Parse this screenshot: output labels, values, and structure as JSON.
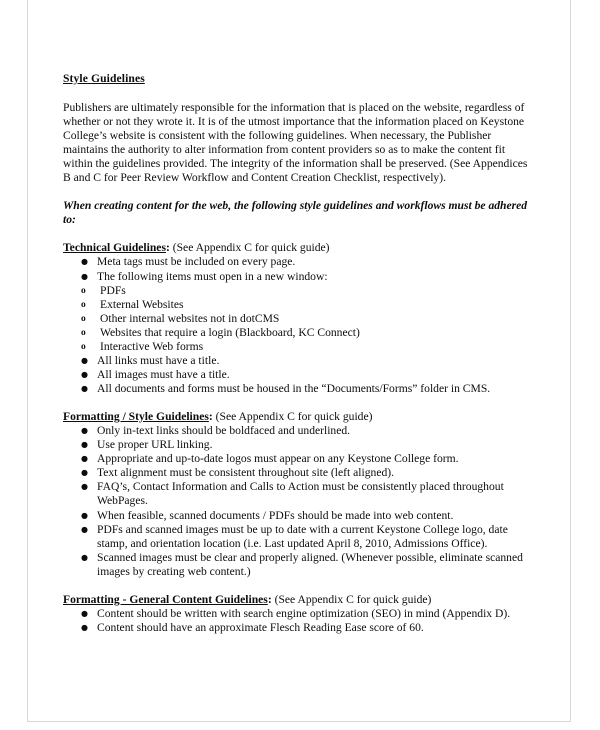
{
  "document": {
    "title": "Style Guidelines",
    "intro_paragraph": "Publishers are ultimately responsible for the information that is placed on the website, regardless of whether or not they wrote it. It is of the utmost importance that the information placed on Keystone College’s website is consistent with the following guidelines. When necessary, the Publisher maintains the authority to alter information from content providers so as to make the content fit within the guidelines provided. The integrity of the information shall be preserved. (See Appendices B and C for Peer Review Workflow and Content Creation Checklist, respectively).",
    "lead_statement": "When creating content for the web, the following style guidelines and workflows must be adhered to:",
    "bullet_glyph": "●",
    "sub_bullet_glyph": "o",
    "sections": [
      {
        "heading": "Technical Guidelines",
        "heading_colon": ":",
        "heading_note": " (See Appendix C for quick guide)",
        "items": [
          {
            "text": "Meta tags must be included on every page."
          },
          {
            "text": "The following items must open in a new window:",
            "subitems": [
              "PDFs",
              "External Websites",
              "Other internal websites not in dotCMS",
              "Websites that require a login (Blackboard, KC Connect)",
              "Interactive Web forms"
            ]
          },
          {
            "text": "All links must have a title."
          },
          {
            "text": "All images must have a title."
          },
          {
            "text": "All documents and forms must be housed in the “Documents/Forms” folder in CMS."
          }
        ]
      },
      {
        "heading": "Formatting / Style Guidelines",
        "heading_colon": ":",
        "heading_note": " (See Appendix C for quick guide)",
        "items": [
          {
            "text": "Only in-text links should be boldfaced and underlined."
          },
          {
            "text": "Use proper URL linking."
          },
          {
            "text": "Appropriate and up-to-date logos must appear on any Keystone College form."
          },
          {
            "text": "Text alignment must be consistent throughout site (left aligned)."
          },
          {
            "text": "FAQ’s, Contact Information and Calls to Action must be consistently placed throughout WebPages."
          },
          {
            "text": "When feasible, scanned documents / PDFs should be made into web content."
          },
          {
            "text": "PDFs and scanned images must be up to date with a current Keystone College logo, date stamp, and orientation location (i.e. Last updated April 8, 2010, Admissions Office)."
          },
          {
            "text": "Scanned images must be clear and properly aligned. (Whenever possible, eliminate scanned images by creating web content.)"
          }
        ]
      },
      {
        "heading": "Formatting - General Content Guidelines",
        "heading_colon": ":",
        "heading_note": " (See Appendix C for quick guide)",
        "items": [
          {
            "text": "Content should be written with search engine optimization (SEO) in mind (Appendix D)."
          },
          {
            "text": "Content should have an approximate Flesch Reading Ease score of 60."
          }
        ]
      }
    ]
  }
}
